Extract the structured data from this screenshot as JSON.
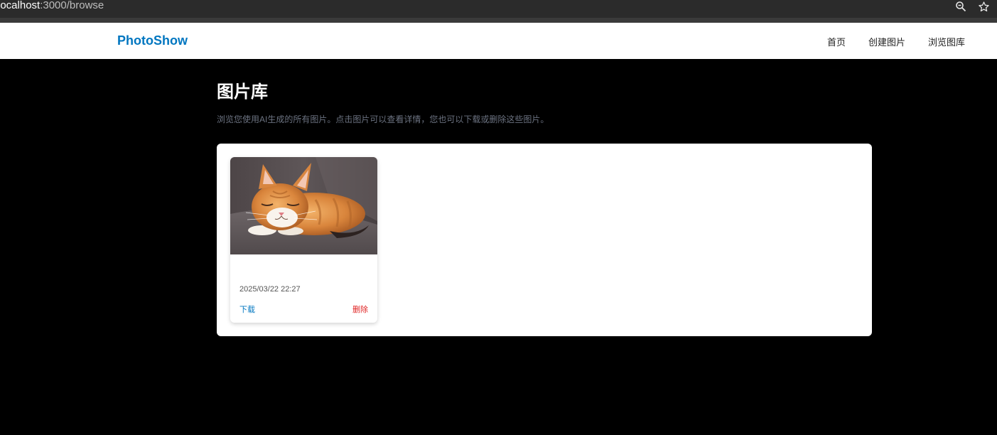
{
  "browser": {
    "url_host": "localhost",
    "url_path": ":3000/browse",
    "zoom_icon": "zoom-icon",
    "star_icon": "star-icon"
  },
  "nav": {
    "brand": "PhotoShow",
    "links": [
      "首页",
      "创建图片",
      "浏览图库"
    ]
  },
  "main": {
    "title": "图片库",
    "subtitle": "浏览您使用AI生成的所有图片。点击图片可以查看详情，您也可以下载或删除这些图片。"
  },
  "gallery": {
    "cards": [
      {
        "image_subject": "sleeping orange tabby cat",
        "date": "2025/03/22 22:27",
        "download_label": "下载",
        "delete_label": "删除"
      }
    ]
  },
  "colors": {
    "brand": "#0076c0",
    "delete": "#e02424",
    "background": "#000000"
  }
}
